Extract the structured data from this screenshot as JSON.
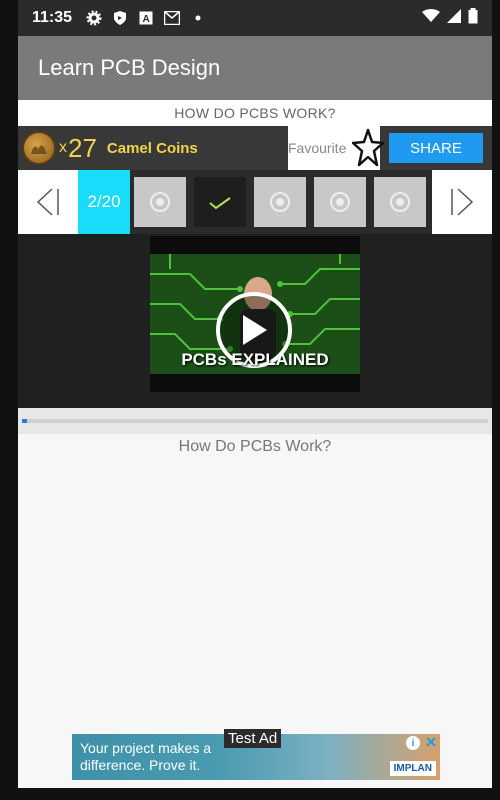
{
  "status_bar": {
    "time": "11:35"
  },
  "app_bar": {
    "title": "Learn PCB Design"
  },
  "lesson": {
    "heading": "HOW DO PCBS WORK?",
    "coins": {
      "multiplier": "x",
      "count": "27",
      "label": "Camel Coins"
    },
    "favourite_label": "Favourite",
    "share_label": "SHARE",
    "page_indicator": "2/20",
    "steps": [
      {
        "state": "incomplete"
      },
      {
        "state": "done"
      },
      {
        "state": "incomplete"
      },
      {
        "state": "incomplete"
      },
      {
        "state": "incomplete"
      }
    ],
    "video_title": "PCBs EXPLAINED",
    "progress": 0.01,
    "caption": "How Do PCBs Work?"
  },
  "ad": {
    "badge": "Test Ad",
    "text": "Your project makes a difference. Prove it.",
    "brand": "IMPLAN"
  },
  "colors": {
    "accent_cyan": "#19dcfa",
    "share_blue": "#1e9af0",
    "coin_yellow": "#f0d44a",
    "progress_blue": "#2a7be4"
  }
}
